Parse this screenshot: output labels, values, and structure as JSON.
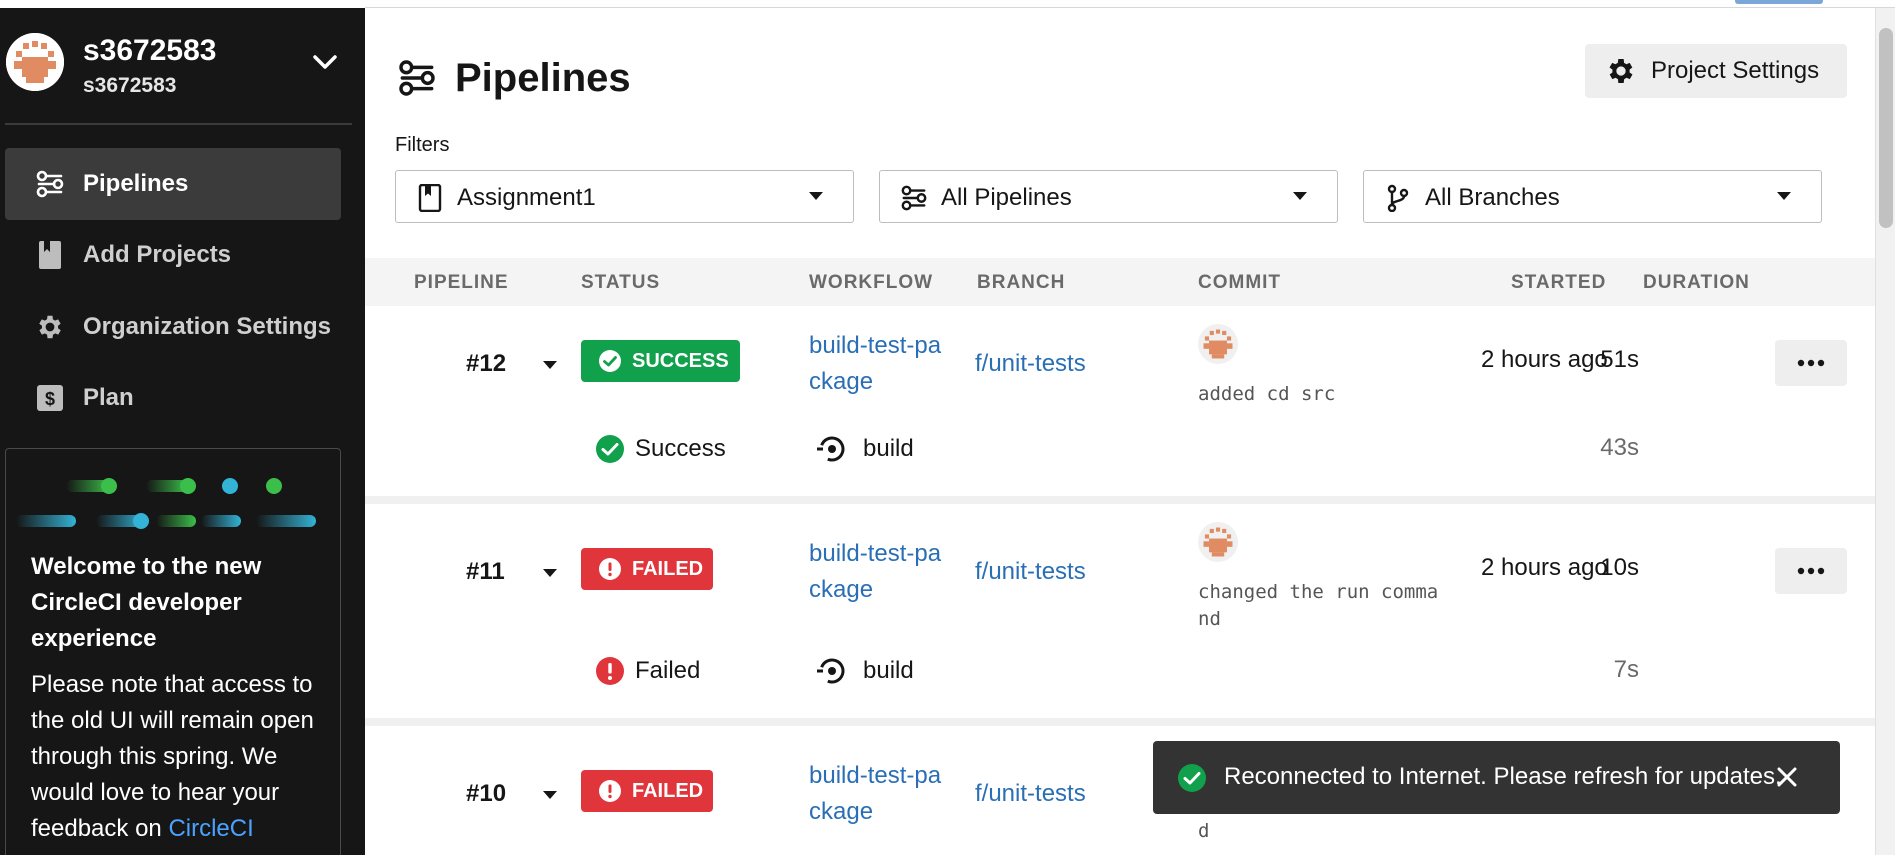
{
  "org": {
    "name": "s3672583",
    "sub": "s3672583"
  },
  "sidebar": {
    "items": [
      {
        "label": "Pipelines",
        "icon": "pipelines-icon",
        "active": true
      },
      {
        "label": "Add Projects",
        "icon": "bookmark-icon"
      },
      {
        "label": "Organization Settings",
        "icon": "gear-icon"
      },
      {
        "label": "Plan",
        "icon": "dollar-icon"
      }
    ],
    "welcome": {
      "title": "Welcome to the new CircleCI developer experience",
      "body": "Please note that access to the old UI will remain open through this spring. We would love to hear your feedback on ",
      "link": "CircleCI"
    }
  },
  "page": {
    "title": "Pipelines",
    "project_settings": "Project Settings",
    "filters_label": "Filters",
    "filters": [
      {
        "label": "Assignment1",
        "icon": "bookmark-icon"
      },
      {
        "label": "All Pipelines",
        "icon": "pipelines-icon"
      },
      {
        "label": "All Branches",
        "icon": "branch-icon"
      }
    ]
  },
  "table": {
    "headers": [
      "PIPELINE",
      "STATUS",
      "WORKFLOW",
      "BRANCH",
      "COMMIT",
      "STARTED",
      "DURATION"
    ],
    "rows": [
      {
        "number": "#12",
        "status": "SUCCESS",
        "status_type": "success",
        "workflow_line1": "build-test-pa",
        "workflow_line2": "ckage",
        "branch": "f/unit-tests",
        "commit": "added cd src",
        "started": "2 hours ago",
        "duration": "51s",
        "sub": {
          "status": "Success",
          "job": "build",
          "duration": "43s"
        }
      },
      {
        "number": "#11",
        "status": "FAILED",
        "status_type": "failed",
        "workflow_line1": "build-test-pa",
        "workflow_line2": "ckage",
        "branch": "f/unit-tests",
        "commit": "changed the run command",
        "started": "2 hours ago",
        "duration": "10s",
        "sub": {
          "status": "Failed",
          "job": "build",
          "duration": "7s"
        }
      },
      {
        "number": "#10",
        "status": "FAILED",
        "status_type": "failed",
        "workflow_line1": "build-test-pa",
        "workflow_line2": "ckage",
        "branch": "f/unit-tests",
        "commit_tail": "d"
      }
    ]
  },
  "toast": {
    "message": "Reconnected to Internet. Please refresh for updates."
  },
  "colors": {
    "success": "#11a04b",
    "failed": "#e0353b",
    "link": "#2a6fb5",
    "sidebar": "#161616"
  }
}
